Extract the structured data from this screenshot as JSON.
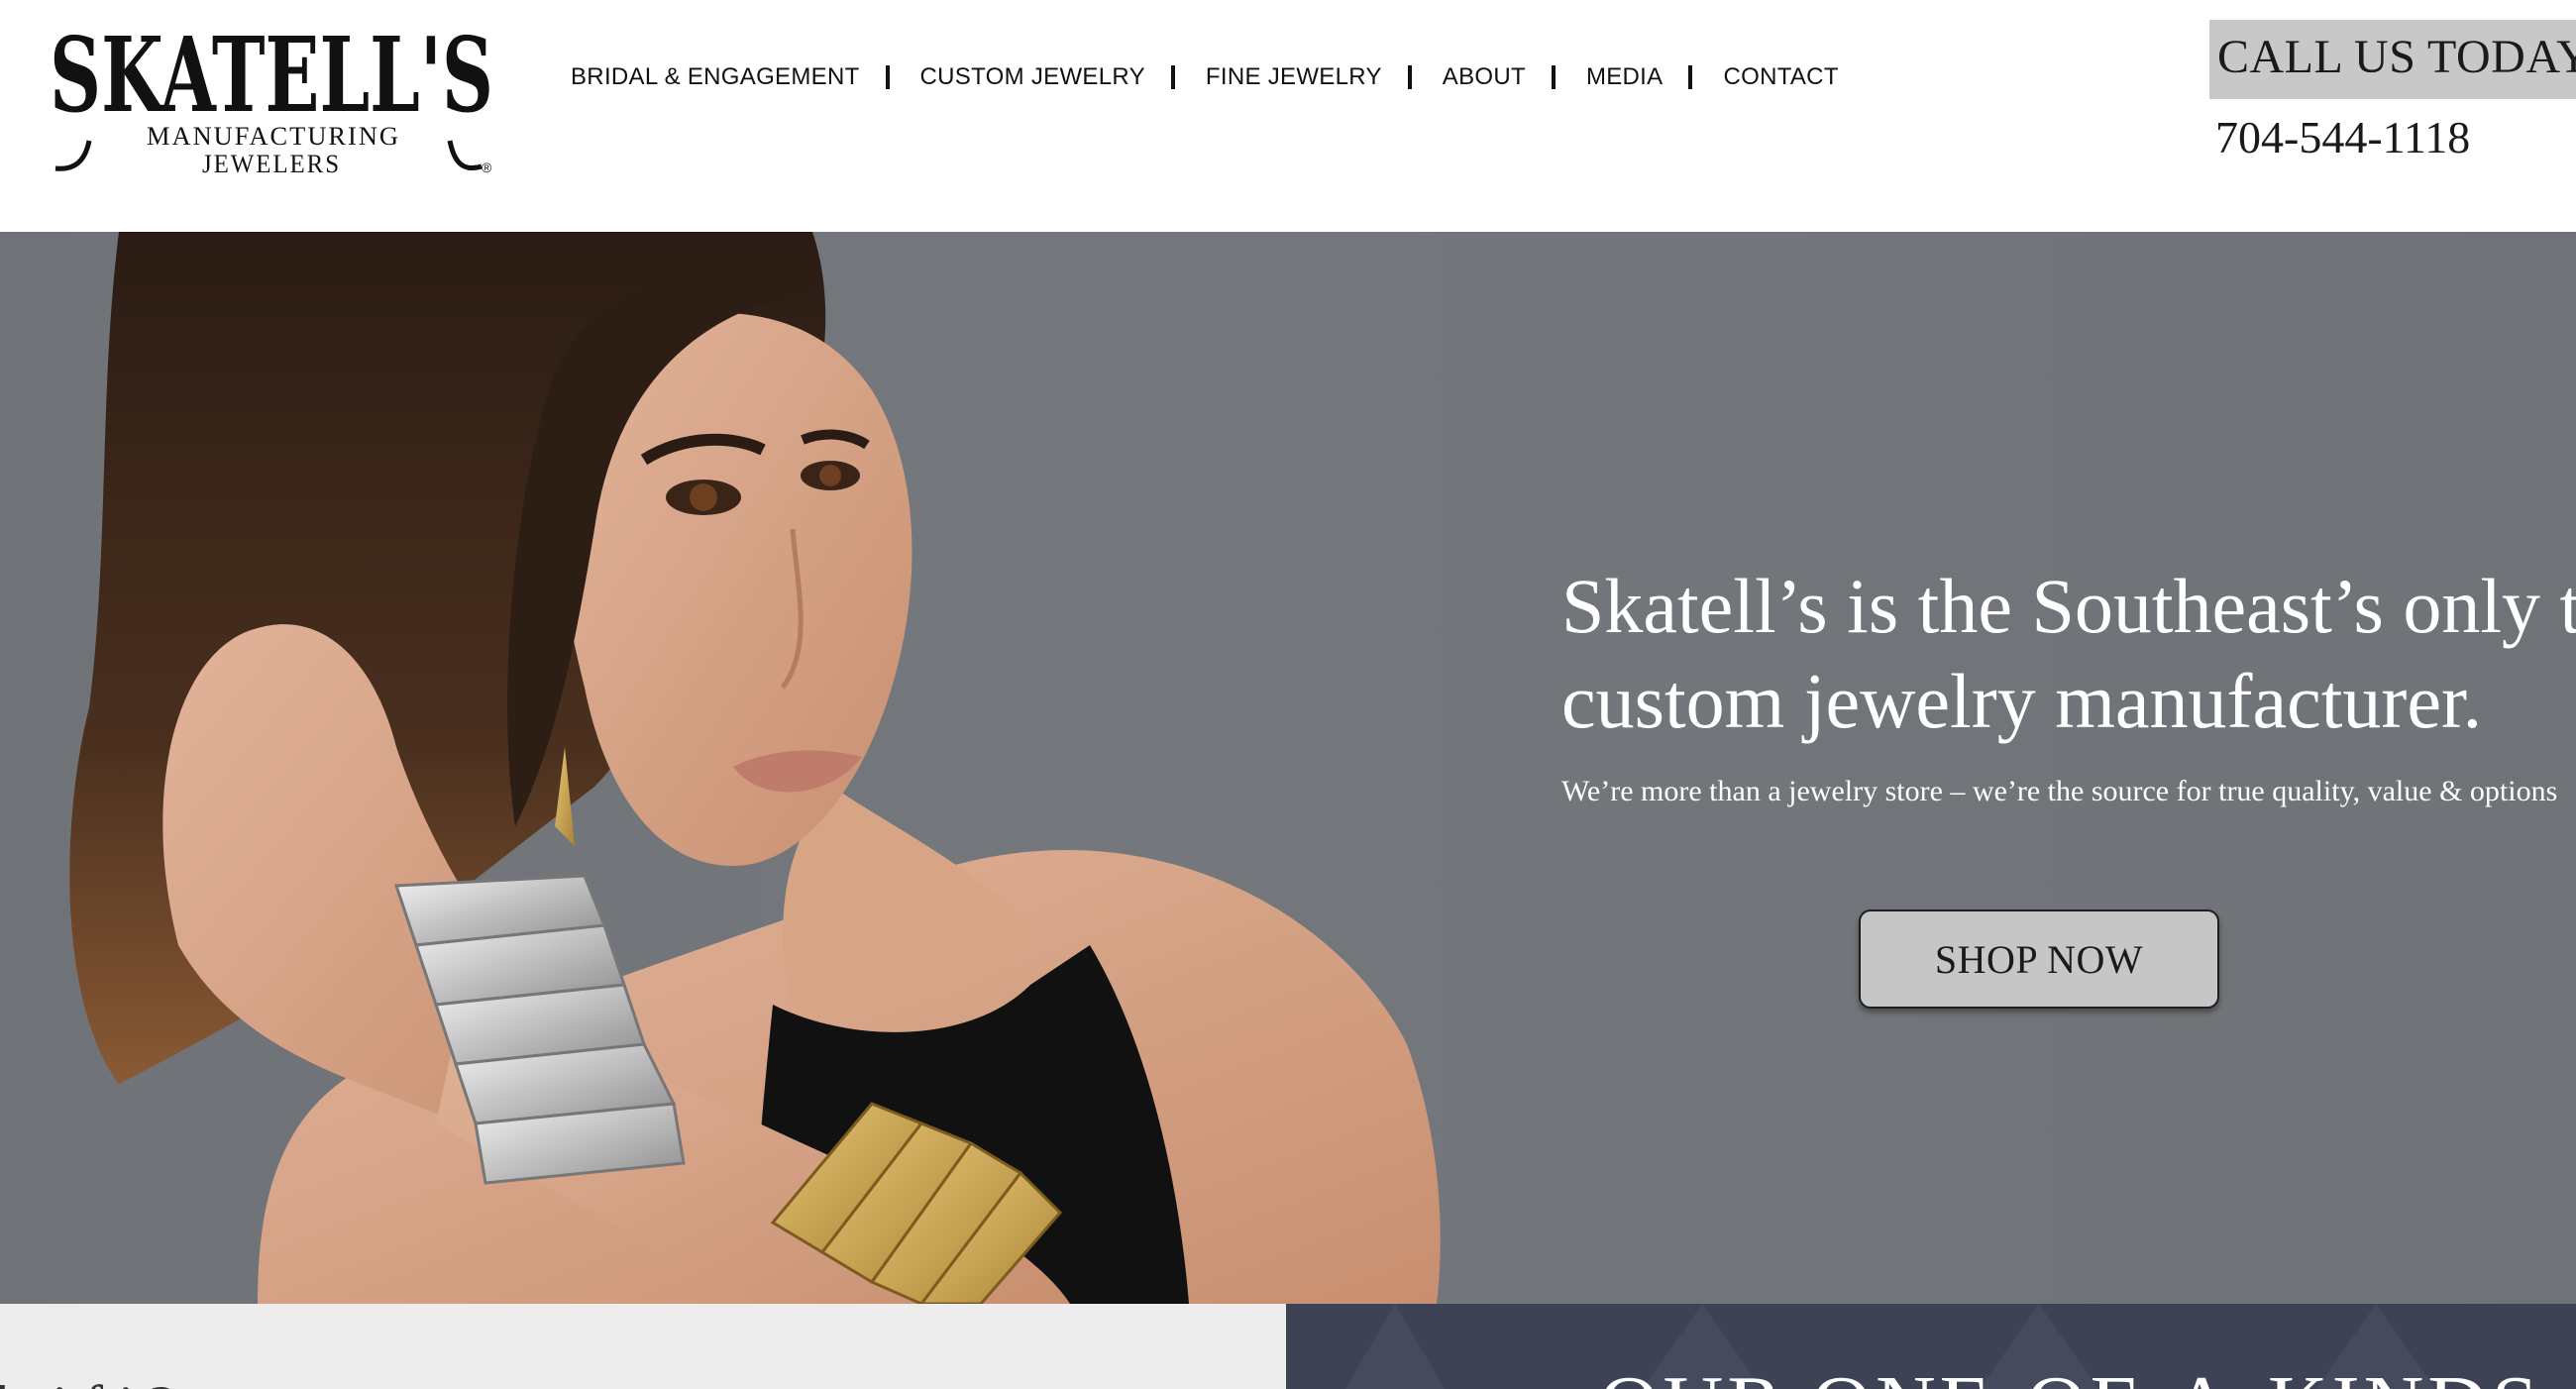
{
  "brand": {
    "logo_word": "SKATELL'S",
    "logo_line1": "MANUFACTURING",
    "logo_line2": "JEWELERS",
    "logo_mark": "®"
  },
  "nav": {
    "items": [
      {
        "label": "BRIDAL & ENGAGEMENT"
      },
      {
        "label": "CUSTOM JEWELRY"
      },
      {
        "label": "FINE JEWELRY"
      },
      {
        "label": "ABOUT"
      },
      {
        "label": "MEDIA"
      },
      {
        "label": "CONTACT"
      }
    ]
  },
  "contact": {
    "call_label": "CALL US TODAY",
    "phone": "704-544-1118"
  },
  "hero": {
    "headline_line1": "Skatell’s is the Southeast’s only tr",
    "headline_line2": "custom jewelry manufacturer.",
    "subtext": "We’re more than a jewelry store – we’re the source for true quality, value & options",
    "cta_label": "SHOP NOW"
  },
  "strip": {
    "left_text": "la    i            f     i  ?",
    "right_text": "OUR ONE-OF-A-KINDS"
  },
  "colors": {
    "hero_bg": "#72767a",
    "call_box_bg": "#c8c8c8",
    "button_bg": "#c6c6c6",
    "strip_left_bg": "#ededed",
    "strip_right_bg": "#3d4254"
  }
}
